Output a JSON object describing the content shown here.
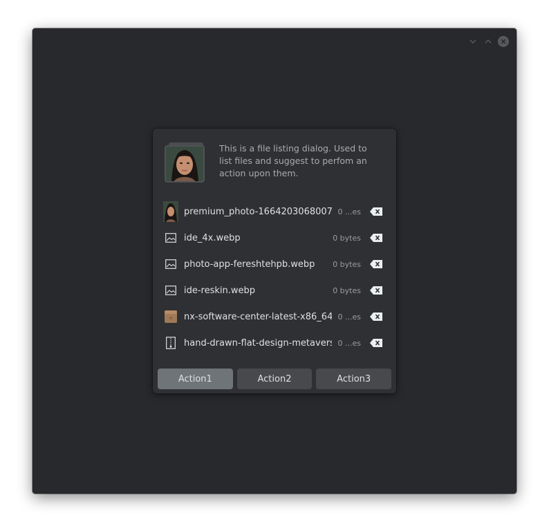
{
  "dialog": {
    "message": "This is a file listing dialog. Used to list files and suggest to perfom an action upon them."
  },
  "files": [
    {
      "name": "premium_photo-1664203068007-...",
      "size": "0 ...es",
      "icon": "photo-thumbnail-icon"
    },
    {
      "name": "ide_4x.webp",
      "size": "0 bytes",
      "icon": "image-file-icon"
    },
    {
      "name": "photo-app-fereshtehpb.webp",
      "size": "0 bytes",
      "icon": "image-file-icon"
    },
    {
      "name": "ide-reskin.webp",
      "size": "0 bytes",
      "icon": "image-file-icon"
    },
    {
      "name": "nx-software-center-latest-x86_64....",
      "size": "0 ...es",
      "icon": "package-icon"
    },
    {
      "name": "hand-drawn-flat-design-metavers...",
      "size": "0 ...es",
      "icon": "archive-file-icon"
    }
  ],
  "actions": {
    "action1": "Action1",
    "action2": "Action2",
    "action3": "Action3"
  },
  "colors": {
    "window_bg": "#28292c",
    "dialog_bg": "#2f3033",
    "primary_button": "#6f7478",
    "secondary_button": "#47494d"
  }
}
